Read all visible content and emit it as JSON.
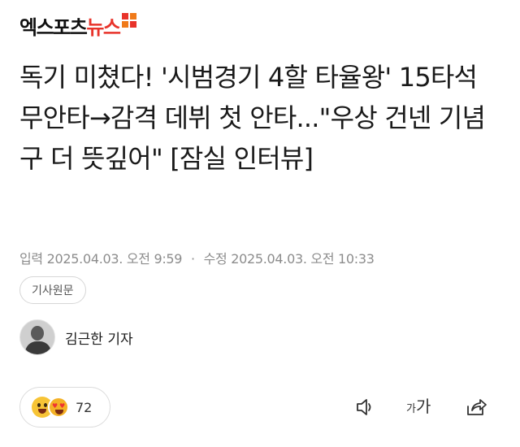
{
  "header": {
    "logo_part1": "엑스포츠",
    "logo_part2": "뉴스"
  },
  "article": {
    "title": "독기 미쳤다! '시범경기 4할 타율왕' 15타석 무안타→감격 데뷔 첫 안타...\"우상 건넨 기념구 더 뜻깊어\" [잠실 인터뷰]",
    "published_label": "입력",
    "published_at": "2025.04.03. 오전 9:59",
    "separator": "·",
    "modified_label": "수정",
    "modified_at": "2025.04.03. 오전 10:33",
    "original_link_label": "기사원문",
    "reporter": "김근한 기자"
  },
  "footer": {
    "reaction_count": "72",
    "font_size_small": "가",
    "font_size_large": "가"
  },
  "colors": {
    "brand_red": "#e8332a",
    "meta_gray": "#8c8c8c"
  },
  "icons": [
    "smile-emoji-icon",
    "heart-eyes-emoji-icon",
    "speaker-icon",
    "font-size-icon",
    "share-icon"
  ]
}
